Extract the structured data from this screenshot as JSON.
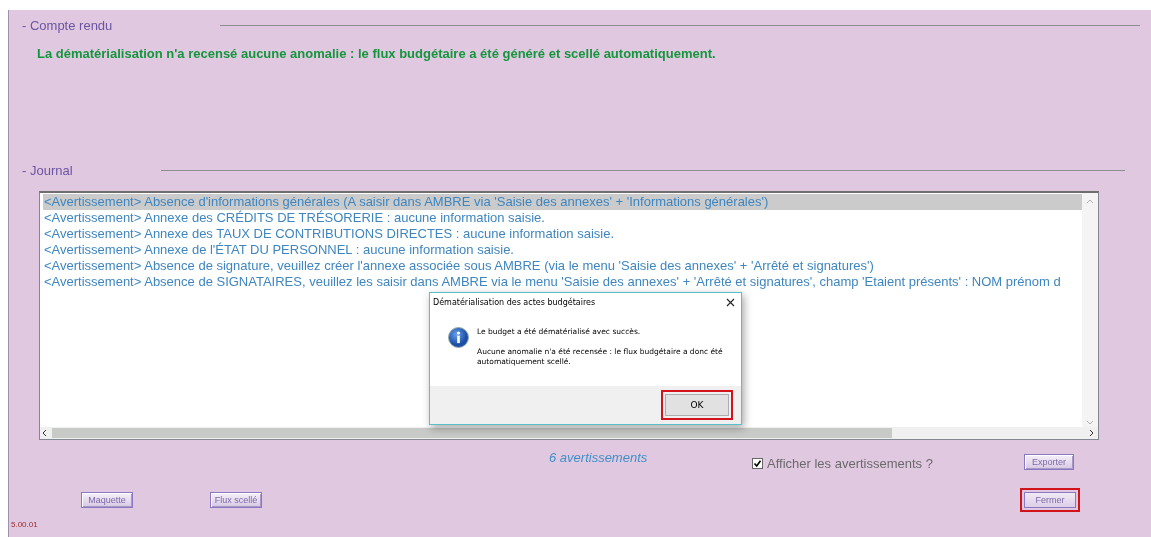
{
  "report": {
    "heading": "- Compte rendu",
    "message": "La dématérialisation n'a recensé aucune anomalie : le flux budgétaire a été généré et scellé automatiquement."
  },
  "journal": {
    "heading": "- Journal",
    "entries": [
      {
        "text": "<Avertissement> Absence d'informations générales (A saisir dans AMBRE via 'Saisie des annexes' + 'Informations générales')",
        "selected": true
      },
      {
        "text": "<Avertissement> Annexe des CRÉDITS DE TRÉSORERIE : aucune information saisie.",
        "selected": false
      },
      {
        "text": "<Avertissement> Annexe des TAUX DE CONTRIBUTIONS DIRECTES : aucune information saisie.",
        "selected": false
      },
      {
        "text": "<Avertissement> Annexe de l'ÉTAT DU PERSONNEL : aucune information saisie.",
        "selected": false
      },
      {
        "text": "<Avertissement> Absence de signature, veuillez créer l'annexe associée sous AMBRE (via le menu 'Saisie des annexes' + 'Arrêté et signatures')",
        "selected": false
      },
      {
        "text": "<Avertissement> Absence de SIGNATAIRES, veuillez les saisir dans AMBRE via le menu 'Saisie des annexes' + 'Arrêté et signatures', champ 'Etaient présents' : NOM prénom d",
        "selected": false
      }
    ],
    "count": "6 avertissements",
    "show_warnings": {
      "label": "Afficher les avertissements ?",
      "checked": true
    },
    "export_button": {
      "label": "Exporter",
      "highlighted": false
    }
  },
  "buttons": [
    {
      "label": "Maquette",
      "highlighted": false
    },
    {
      "label": "Flux scellé",
      "highlighted": false
    },
    {
      "label": "Fermer",
      "highlighted": true
    }
  ],
  "version": "5.00.01",
  "dialog": {
    "title": "Dématérialisation des actes budgétaires",
    "message": "Le budget a été dématérialisé avec succès.",
    "detail": "Aucune anomalie n'a été recensée : le flux budgétaire a donc été automatiquement scellé.",
    "ok_button": {
      "label": "OK",
      "highlighted": true
    }
  }
}
